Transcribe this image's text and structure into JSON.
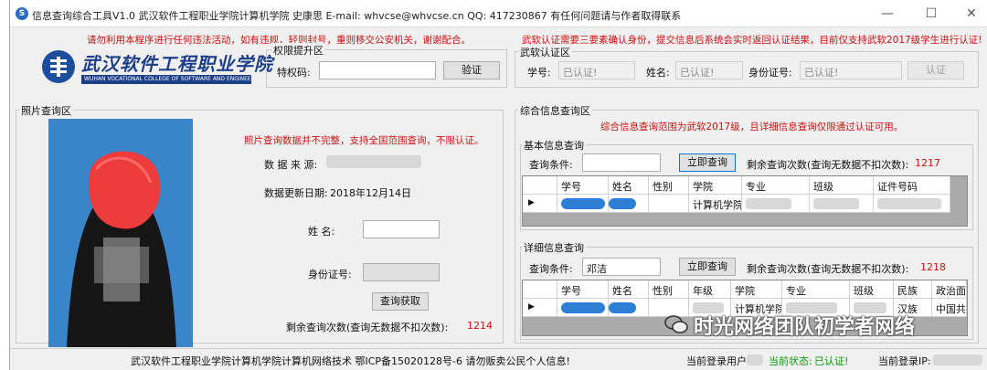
{
  "window": {
    "title": "信息查询综合工具V1.0   武汉软件工程职业学院计算机学院  史康思  E-mail: whvcse@whvcse.cn  QQ: 417230867  有任何问题请与作者取得联系",
    "minimize": "—",
    "maximize": "☐",
    "close": "✕"
  },
  "warnings": {
    "top_left": "请勿利用本程序进行任何违法活动，如有违规，轻则封号，重则移交公安机关，谢谢配合。",
    "top_right": "武软认证需要三要素确认身份，提交信息后系统会实时返回认证结果，目前仅支持武软2017级学生进行认证!"
  },
  "logo": {
    "cn": "武汉软件工程职业学院",
    "en": "WUHAN VOCATIONAL COLLEGE OF SOFTWARE AND ENGINEERING"
  },
  "privilege": {
    "group_title": "权限提升区",
    "code_label": "特权码:",
    "code_value": "",
    "verify_button": "验证"
  },
  "auth": {
    "group_title": "武软认证区",
    "student_no_label": "学号:",
    "student_no_value": "已认证!",
    "name_label": "姓名:",
    "name_value": "已认证!",
    "id_label": "身份证号:",
    "id_value": "已认证!",
    "auth_button": "认证"
  },
  "photo": {
    "group_title": "照片查询区",
    "notice": "照片查询数据并不完整，支持全国范围查询，不限认证。",
    "source_label": "数 据 来 源:",
    "updated_label": "数据更新日期:",
    "updated_value": "2018年12月14日",
    "name_label": "姓    名:",
    "id_label": "身份证号:",
    "query_button": "查询获取",
    "remaining_label": "剩余查询次数(查询无数据不扣次数):",
    "remaining_value": "1214"
  },
  "combined": {
    "group_title": "综合信息查询区",
    "notice": "综合信息查询范围为武软2017级，且详细信息查询仅限通过认证可用。",
    "basic": {
      "title": "基本信息查询",
      "cond_label": "查询条件:",
      "cond_value": "",
      "query_button": "立即查询",
      "remaining_label": "剩余查询次数(查询无数据不扣次数):",
      "remaining_value": "1217",
      "columns": [
        "学号",
        "姓名",
        "性别",
        "学院",
        "专业",
        "班级",
        "证件号码"
      ],
      "row": [
        "",
        "",
        "",
        "计算机学院",
        "",
        "",
        ""
      ],
      "row_marker": "▶"
    },
    "detail": {
      "title": "详细信息查询",
      "cond_label": "查询条件:",
      "cond_value": "邓洁",
      "query_button": "立即查询",
      "remaining_label": "剩余查询次数(查询无数据不扣次数):",
      "remaining_value": "1218",
      "columns": [
        "学号",
        "姓名",
        "性别",
        "年级",
        "学院",
        "专业",
        "班级",
        "民族",
        "政治面"
      ],
      "row": [
        "",
        "",
        "",
        "",
        "计算机学院",
        "",
        "",
        "汉族",
        "中国共"
      ],
      "row_marker": "▶"
    }
  },
  "status": {
    "footer_text": "武汉软件工程职业学院计算机学院计算机网络技术  鄂ICP备15020128号-6  请勿贩卖公民个人信息!",
    "user_label": "当前登录用户:",
    "state_label": "当前状态:",
    "state_value": "已认证!",
    "ip_label": "当前登录IP:"
  },
  "watermark": "时光网络团队初学者网络"
}
